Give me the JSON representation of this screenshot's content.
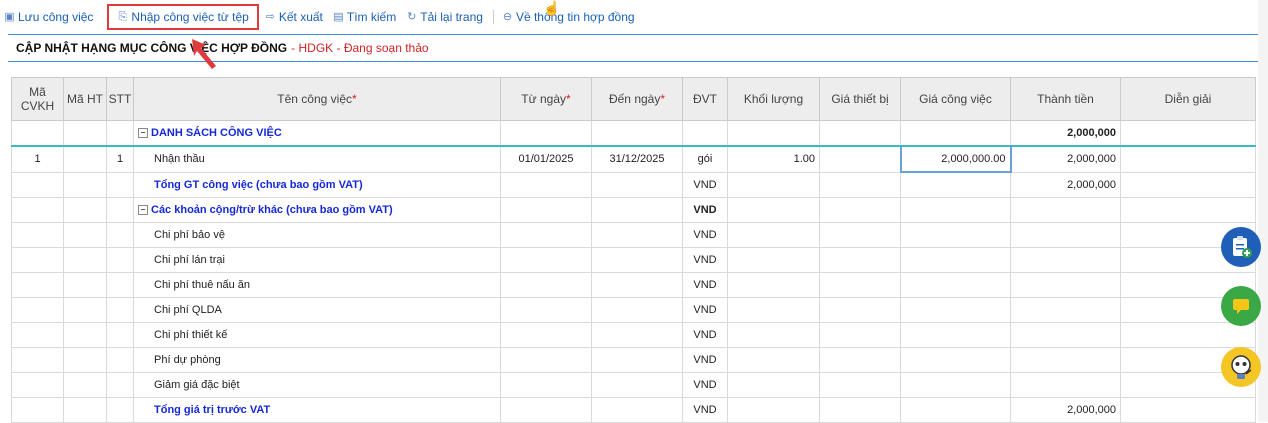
{
  "toolbar": {
    "save": "Lưu công việc",
    "import": "Nhập công việc từ tệp",
    "export": "Kết xuất",
    "search": "Tìm kiếm",
    "reload": "Tải lại trang",
    "back": "Về thông tin hợp đồng"
  },
  "title": {
    "main": "CẬP NHẬT HẠNG MỤC CÔNG VIỆC HỢP ĐỒNG",
    "sub": "- HDGK - Đang soạn thảo"
  },
  "table": {
    "headers": [
      "Mã CVKH",
      "Mã HT",
      "STT",
      "Tên công việc",
      "Từ ngày",
      "Đến ngày",
      "ĐVT",
      "Khối lượng",
      "Giá thiết bị",
      "Giá công việc",
      "Thành tiền",
      "Diễn giải"
    ],
    "required_mark": "*",
    "group1": {
      "name": "DANH SÁCH CÔNG VIỆC",
      "total": "2,000,000"
    },
    "row1": {
      "ma_cvkh": "1",
      "stt": "1",
      "name": "Nhận thầu",
      "from": "01/01/2025",
      "to": "31/12/2025",
      "unit": "gói",
      "qty": "1.00",
      "price": "2,000,000.00",
      "amount": "2,000,000"
    },
    "total_work": {
      "name": "Tổng GT công việc (chưa bao gồm VAT)",
      "unit": "VND",
      "amount": "2,000,000"
    },
    "group2": {
      "name": "Các khoản cộng/trừ khác (chưa bao gồm VAT)",
      "unit": "VND"
    },
    "others": [
      {
        "name": "Chi phí bảo vệ",
        "unit": "VND"
      },
      {
        "name": "Chi phí lán trại",
        "unit": "VND"
      },
      {
        "name": "Chi phí thuê nấu ăn",
        "unit": "VND"
      },
      {
        "name": "Chi phí QLDA",
        "unit": "VND"
      },
      {
        "name": "Chi phí thiết kế",
        "unit": "VND"
      },
      {
        "name": "Phí dự phòng",
        "unit": "VND"
      },
      {
        "name": "Giảm giá đặc biệt",
        "unit": "VND"
      }
    ],
    "total_before_vat": {
      "name": "Tổng giá trị trước VAT",
      "unit": "VND",
      "amount": "2,000,000"
    }
  },
  "colors": {
    "accent": "#1a5fb4",
    "highlight": "#e0393e",
    "group_text": "#1428d8"
  },
  "icons": [
    "save-icon",
    "import-icon",
    "export-icon",
    "search-icon",
    "reload-icon",
    "back-icon",
    "clipboard-add-icon",
    "chat-icon",
    "robot-icon"
  ]
}
